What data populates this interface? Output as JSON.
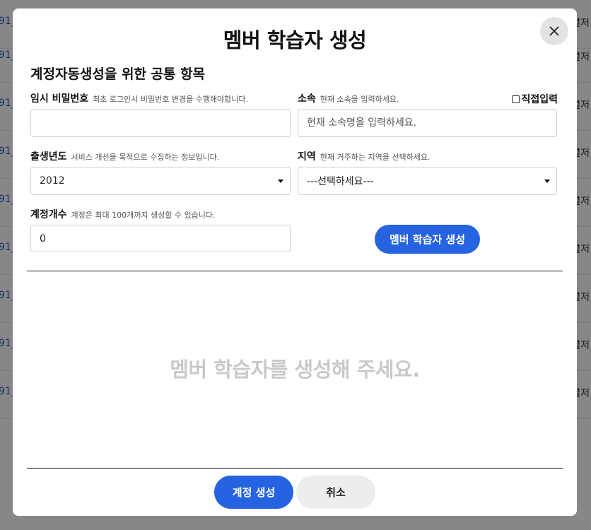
{
  "background": {
    "rows": [
      {
        "left": "91_",
        "right": "별저"
      },
      {
        "left": "91_",
        "right": "별저"
      },
      {
        "left": "91_",
        "right": "별저"
      },
      {
        "left": "91_",
        "right": "별저"
      },
      {
        "left": "91_",
        "right": "별저"
      },
      {
        "left": "91_",
        "right": "별저"
      },
      {
        "left": "91_",
        "right": "별저"
      },
      {
        "left": "91_",
        "right": "별저"
      },
      {
        "left": "91_",
        "right": "별저"
      }
    ]
  },
  "modal": {
    "title": "멤버 학습자 생성",
    "close_icon": "close-icon",
    "section_title": "계정자동생성을 위한 공통 항목",
    "password": {
      "label": "임시 비밀번호",
      "hint": "최초 로그인시 비밀번호 변경을 수행해야합니다.",
      "value": "",
      "placeholder": ""
    },
    "affiliation": {
      "label": "소속",
      "hint": "현재 소속을 입력하세요.",
      "placeholder": "현재 소속명을 입력하세요.",
      "direct_input_label": "직접입력",
      "direct_input_checked": false
    },
    "birth_year": {
      "label": "출생년도",
      "hint": "서비스 개선을 목적으로 수집하는 정보입니다.",
      "selected": "2012"
    },
    "region": {
      "label": "지역",
      "hint": "현재 거주하는 지역을 선택하세요.",
      "selected": "---선택하세요---"
    },
    "account_count": {
      "label": "계정개수",
      "hint": "계정은 최대 100개까지 생성할 수 있습니다.",
      "value": "0"
    },
    "create_member_button": "멤버 학습자 생성",
    "empty_message": "멤버 학습자를 생성해 주세요.",
    "footer": {
      "create_account_button": "계정 생성",
      "cancel_button": "취소"
    }
  },
  "colors": {
    "primary": "#2563e0",
    "overlay": "#000000",
    "muted_text": "#c9c9c9"
  }
}
